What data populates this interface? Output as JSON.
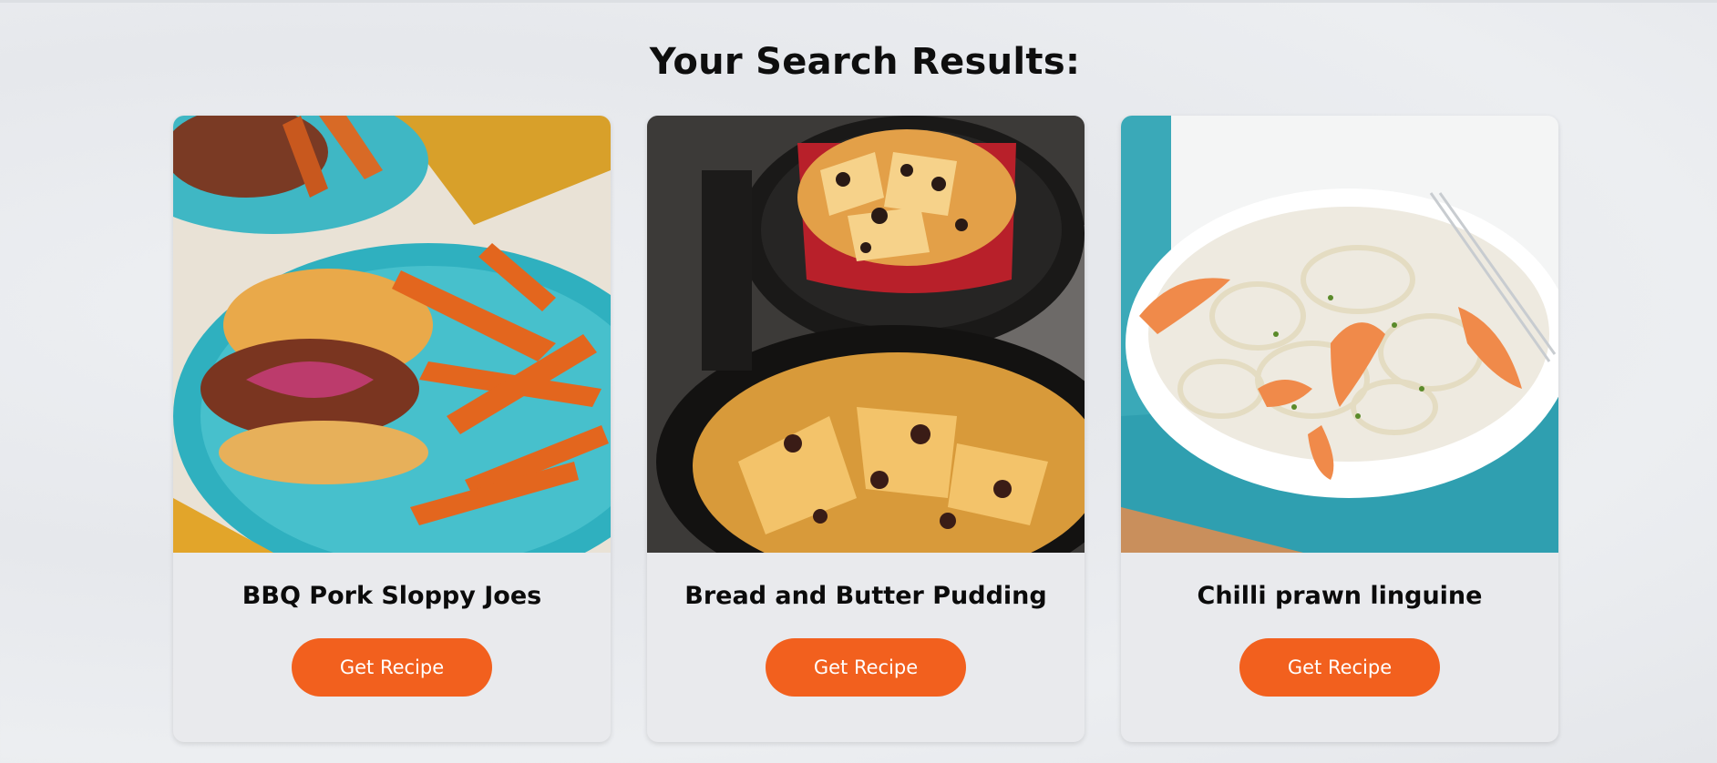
{
  "page": {
    "heading": "Your Search Results:"
  },
  "results": [
    {
      "title": "BBQ Pork Sloppy Joes",
      "button_label": "Get Recipe",
      "image": "bbq-pork-sloppy-joes-photo"
    },
    {
      "title": "Bread and Butter Pudding",
      "button_label": "Get Recipe",
      "image": "bread-and-butter-pudding-photo"
    },
    {
      "title": "Chilli prawn linguine",
      "button_label": "Get Recipe",
      "image": "chilli-prawn-linguine-photo"
    }
  ],
  "colors": {
    "accent": "#f2601e",
    "card_background": "#e9eaed",
    "heading_text": "#0e0e0e"
  }
}
